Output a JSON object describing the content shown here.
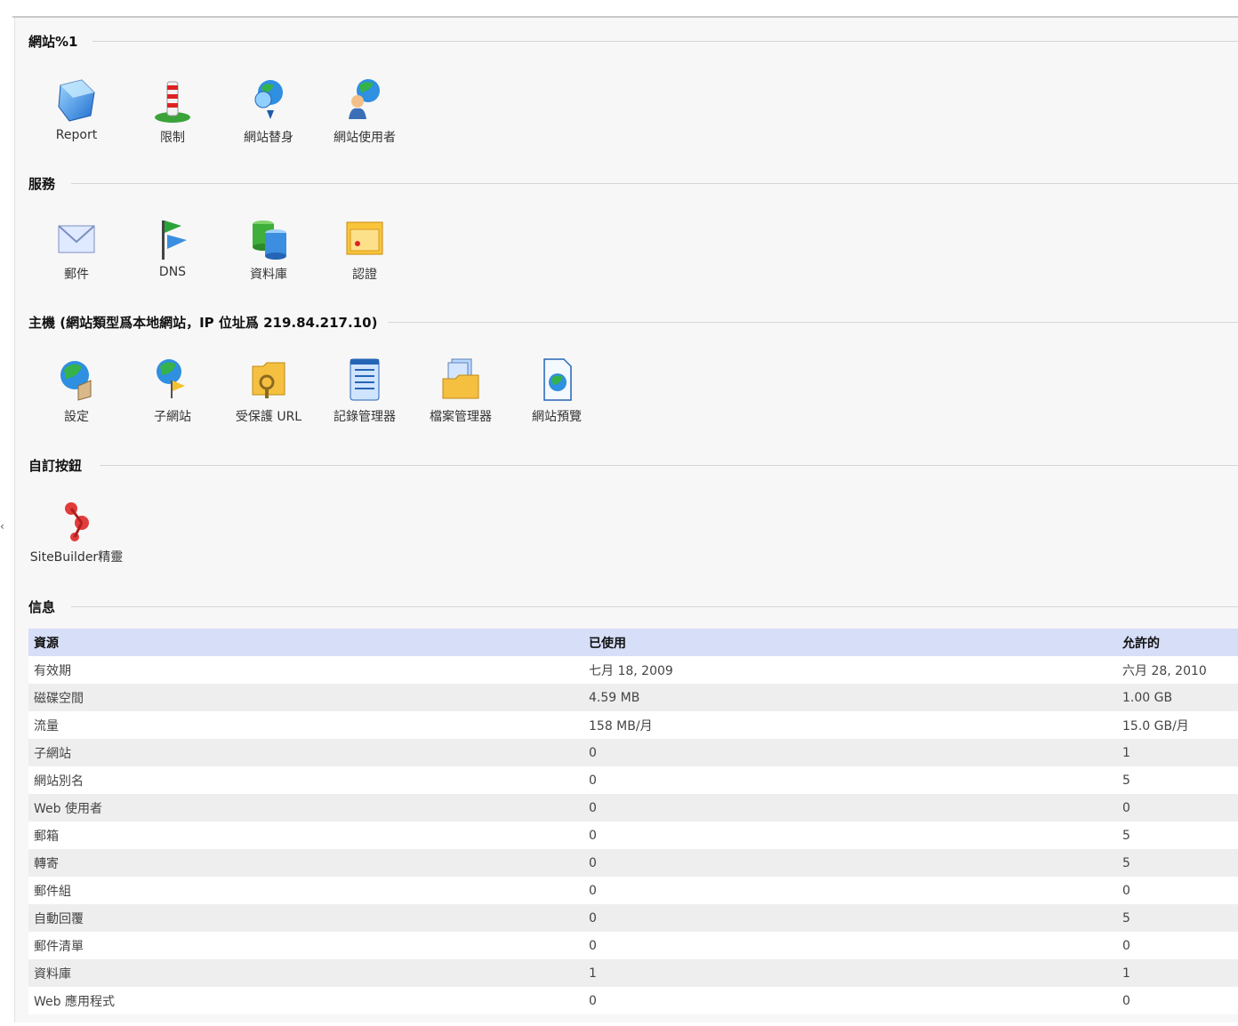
{
  "sections": {
    "site": {
      "title": "網站%1",
      "buttons": [
        {
          "label": "Report",
          "icon": "report-icon"
        },
        {
          "label": "限制",
          "icon": "limits-icon"
        },
        {
          "label": "網站替身",
          "icon": "site-alias-icon"
        },
        {
          "label": "網站使用者",
          "icon": "web-users-icon"
        }
      ]
    },
    "services": {
      "title": "服務",
      "buttons": [
        {
          "label": "郵件",
          "icon": "mail-icon"
        },
        {
          "label": "DNS",
          "icon": "dns-icon"
        },
        {
          "label": "資料庫",
          "icon": "database-icon"
        },
        {
          "label": "認證",
          "icon": "certificate-icon"
        }
      ]
    },
    "hosting": {
      "title": "主機 (網站類型爲本地網站，IP 位址爲 219.84.217.10)",
      "buttons": [
        {
          "label": "設定",
          "icon": "settings-icon"
        },
        {
          "label": "子網站",
          "icon": "subdomain-icon"
        },
        {
          "label": "受保護 URL",
          "icon": "protected-url-icon"
        },
        {
          "label": "記錄管理器",
          "icon": "log-manager-icon"
        },
        {
          "label": "檔案管理器",
          "icon": "file-manager-icon"
        },
        {
          "label": "網站預覽",
          "icon": "site-preview-icon"
        }
      ]
    },
    "custom": {
      "title": "自訂按鈕",
      "buttons": [
        {
          "label": "SiteBuilder精靈",
          "icon": "sitebuilder-icon"
        }
      ]
    },
    "info": {
      "title": "信息",
      "columns": [
        "資源",
        "已使用",
        "允許的"
      ],
      "rows": [
        [
          "有效期",
          "七月 18, 2009",
          "六月 28, 2010"
        ],
        [
          "磁碟空間",
          "4.59 MB",
          "1.00 GB"
        ],
        [
          "流量",
          "158 MB/月",
          "15.0 GB/月"
        ],
        [
          "子網站",
          "0",
          "1"
        ],
        [
          "網站別名",
          "0",
          "5"
        ],
        [
          "Web 使用者",
          "0",
          "0"
        ],
        [
          "郵箱",
          "0",
          "5"
        ],
        [
          "轉寄",
          "0",
          "5"
        ],
        [
          "郵件組",
          "0",
          "0"
        ],
        [
          "自動回覆",
          "0",
          "5"
        ],
        [
          "郵件清單",
          "0",
          "0"
        ],
        [
          "資料庫",
          "1",
          "1"
        ],
        [
          "Web 應用程式",
          "0",
          "0"
        ]
      ]
    }
  },
  "colors": {
    "header_bg": "#d6def8",
    "panel_bg": "#f7f7f7",
    "row_alt": "#eeeeee"
  }
}
